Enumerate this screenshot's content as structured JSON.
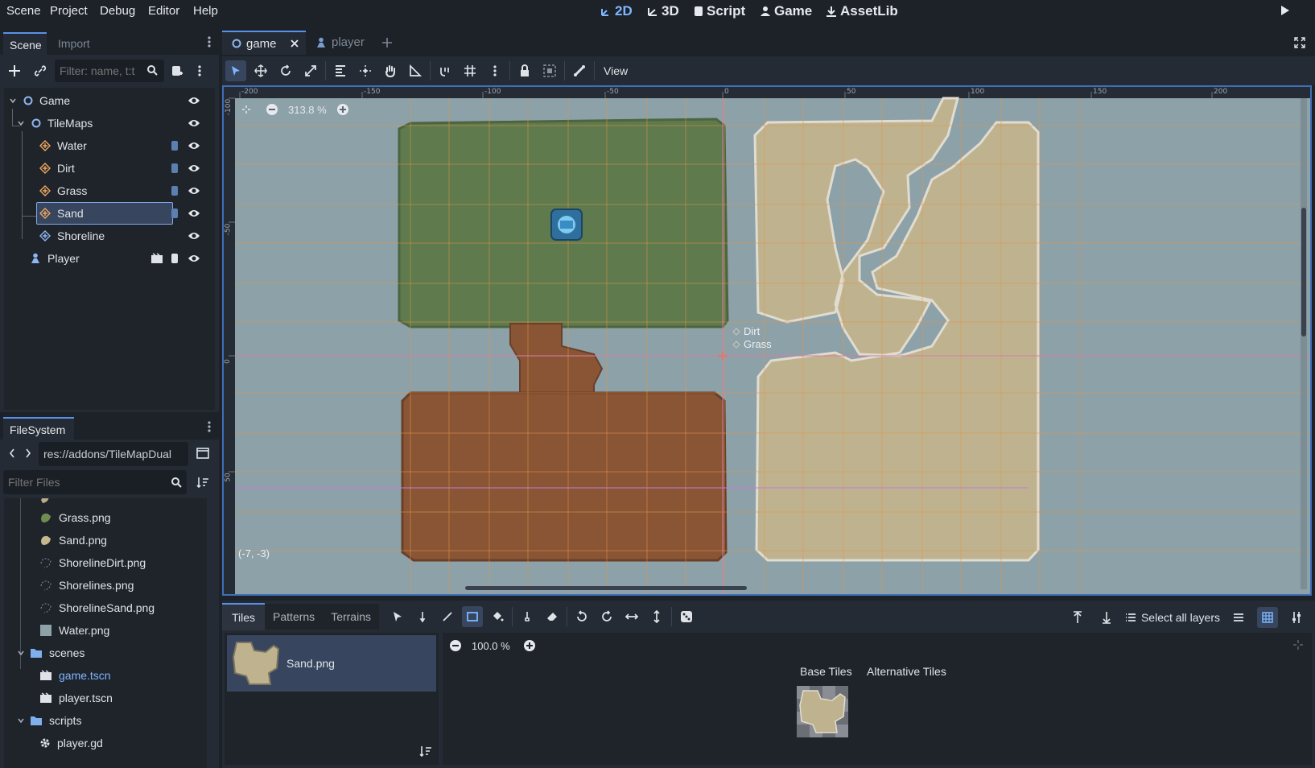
{
  "menu": {
    "scene": "Scene",
    "project": "Project",
    "debug": "Debug",
    "editor": "Editor",
    "help": "Help"
  },
  "workspaces": {
    "w2d": "2D",
    "w3d": "3D",
    "script": "Script",
    "game": "Game",
    "assetlib": "AssetLib"
  },
  "scene_dock": {
    "tabs": {
      "scene": "Scene",
      "import": "Import"
    },
    "filter_placeholder": "Filter: name, t:t",
    "tree": {
      "game": "Game",
      "tilemaps": "TileMaps",
      "water": "Water",
      "dirt": "Dirt",
      "grass": "Grass",
      "sand": "Sand",
      "shoreline": "Shoreline",
      "player": "Player"
    }
  },
  "filesystem": {
    "tab": "FileSystem",
    "path": "res://addons/TileMapDual",
    "filter_placeholder": "Filter Files",
    "items": {
      "grass_png": "Grass.png",
      "sand_png": "Sand.png",
      "shoreline_dirt_png": "ShorelineDirt.png",
      "shorelines_png": "Shorelines.png",
      "shoreline_sand_png": "ShorelineSand.png",
      "water_png": "Water.png",
      "scenes": "scenes",
      "game_tscn": "game.tscn",
      "player_tscn": "player.tscn",
      "scripts": "scripts",
      "player_gd": "player.gd"
    }
  },
  "editor_tabs": {
    "game": "game",
    "player": "player"
  },
  "toolbar": {
    "view": "View"
  },
  "viewport": {
    "zoom": "313.8 %",
    "coords": "(-7, -3)",
    "label_dirt": "Dirt",
    "label_grass": "Grass",
    "ruler_top": [
      "-200",
      "-150",
      "-100",
      "-50",
      "0",
      "50",
      "100",
      "150",
      "200"
    ],
    "ruler_left": [
      "-100",
      "-50",
      "0",
      "50"
    ],
    "colors": {
      "water": "#8da2a8",
      "grass": "#5f7a4c",
      "dirt": "#8a5535",
      "sand": "#bfb38f",
      "grid": "#e0954a"
    }
  },
  "tile_panel": {
    "tabs": {
      "tiles": "Tiles",
      "patterns": "Patterns",
      "terrains": "Terrains"
    },
    "select_all_layers": "Select all layers",
    "source_name": "Sand.png",
    "zoom": "100.0 %",
    "base_tiles": "Base Tiles",
    "alternative_tiles": "Alternative Tiles"
  }
}
